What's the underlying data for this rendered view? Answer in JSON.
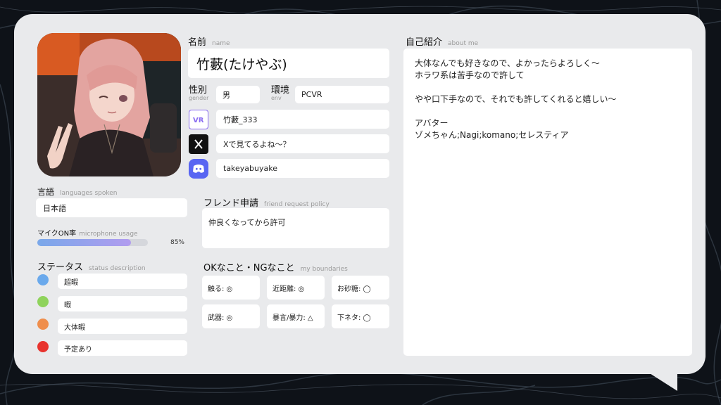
{
  "profile": {
    "name_label": "名前",
    "name_label_en": "name",
    "name": "竹藪(たけやぶ)",
    "gender_label": "性別",
    "gender_label_en": "gender",
    "gender": "男",
    "env_label": "環境",
    "env_label_en": "env",
    "env": "PCVR"
  },
  "socials": [
    {
      "icon": "vrchat-icon",
      "value": "竹藪_333"
    },
    {
      "icon": "x-icon",
      "value": "Xで見てるよね〜？"
    },
    {
      "icon": "discord-icon",
      "value": "takeyabuyake"
    }
  ],
  "languages": {
    "label": "言語",
    "label_en": "languages spoken",
    "value": "日本語"
  },
  "mic": {
    "label": "マイクON率",
    "label_en": "microphone usage",
    "percent": 85,
    "percent_text": "85%"
  },
  "status": {
    "label": "ステータス",
    "label_en": "status description",
    "items": [
      {
        "color": "#6aa9ec",
        "text": "超暇"
      },
      {
        "color": "#8fd35c",
        "text": "暇"
      },
      {
        "color": "#ef8e4c",
        "text": "大体暇"
      },
      {
        "color": "#e8332e",
        "text": "予定あり"
      }
    ]
  },
  "friend": {
    "label": "フレンド申請",
    "label_en": "friend request policy",
    "value": "仲良くなってから許可"
  },
  "boundaries": {
    "label": "OKなこと・NGなこと",
    "label_en": "my boundaries",
    "items": [
      "触る: ◎",
      "近距離: ◎",
      "お砂糖: ◯",
      "武器: ◎",
      "暴言/暴力: △",
      "下ネタ: ◯"
    ]
  },
  "about": {
    "label": "自己紹介",
    "label_en": "about me",
    "lines": [
      "大体なんでも好きなので、よかったらよろしく〜",
      "ホラワ系は苦手なので許して",
      "",
      "やや口下手なので、それでも許してくれると嬉しい〜",
      "",
      "アバター",
      "ゾメちゃん;Nagi;komano;セレスティア"
    ]
  },
  "colors": {
    "card_bg": "#e9eaec",
    "field_bg": "#ffffff",
    "page_bg": "#0e1218",
    "bar_start": "#7aa8ea",
    "bar_end": "#b19cef",
    "discord": "#5865f2",
    "vrchat": "#8a6cf0"
  }
}
